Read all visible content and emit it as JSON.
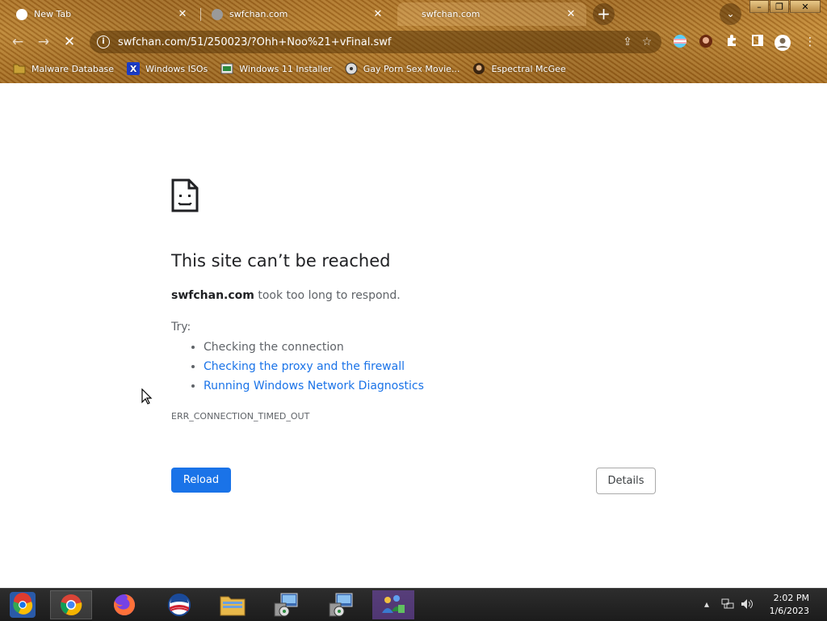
{
  "tabs": [
    {
      "title": "New Tab",
      "favicon": "chrome-icon",
      "active": false
    },
    {
      "title": "swfchan.com",
      "favicon": "globe-icon",
      "active": false
    },
    {
      "title": "swfchan.com",
      "favicon": "none",
      "active": true
    }
  ],
  "toolbar": {
    "url": "swfchan.com/51/250023/?Ohh+Noo%21+vFinal.swf"
  },
  "bookmarks": [
    {
      "label": "Malware Database",
      "icon": "folder-icon"
    },
    {
      "label": "Windows ISOs",
      "icon": "x-logo-icon"
    },
    {
      "label": "Windows 11 Installer",
      "icon": "installer-icon"
    },
    {
      "label": "Gay Porn Sex Movie...",
      "icon": "disc-icon"
    },
    {
      "label": "Espectral McGee",
      "icon": "avatar-icon"
    }
  ],
  "error": {
    "title": "This site can’t be reached",
    "host": "swfchan.com",
    "message": " took too long to respond.",
    "try_label": "Try:",
    "suggestions": [
      "Checking the connection",
      "Checking the proxy and the firewall",
      "Running Windows Network Diagnostics"
    ],
    "code": "ERR_CONNECTION_TIMED_OUT",
    "reload_label": "Reload",
    "details_label": "Details"
  },
  "taskbar": {
    "apps": [
      "chrome-os-icon",
      "chrome-icon",
      "firefox-icon",
      "obama-logo-icon",
      "file-explorer-icon",
      "installer-icon",
      "installer-icon",
      "network-people-icon"
    ],
    "time": "2:02 PM",
    "date": "1/6/2023"
  },
  "colors": {
    "accent": "#1a73e8",
    "frame": "#b5782a"
  }
}
